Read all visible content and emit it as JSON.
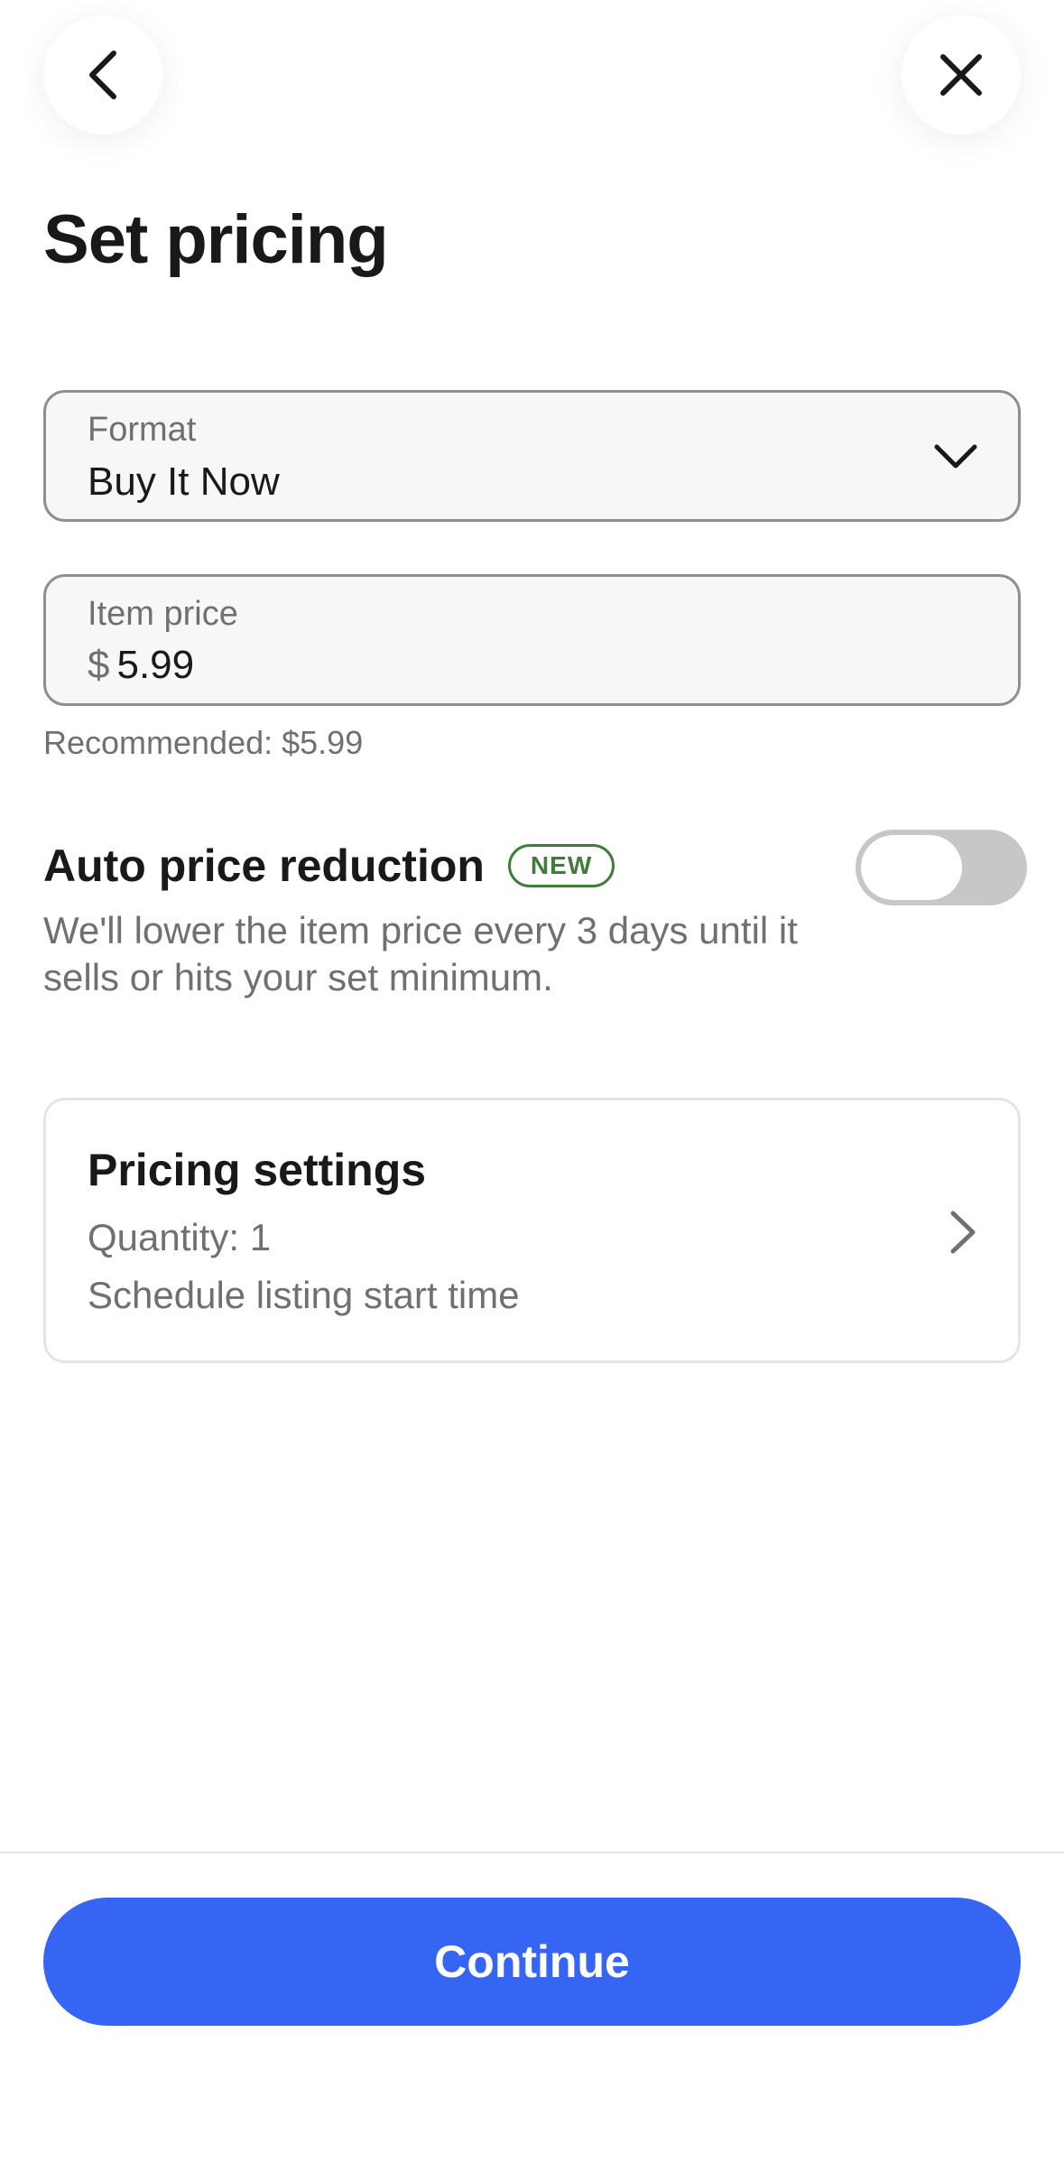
{
  "header": {
    "back_icon": "chevron-left-icon",
    "close_icon": "close-icon",
    "title": "Set pricing"
  },
  "format_field": {
    "label": "Format",
    "value": "Buy It Now",
    "icon": "chevron-down-icon"
  },
  "price_field": {
    "label": "Item price",
    "currency": "$",
    "value": "5.99"
  },
  "recommended": "Recommended: $5.99",
  "auto_price_reduction": {
    "title": "Auto price reduction",
    "badge": "NEW",
    "description": "We'll lower the item price every 3 days until it sells or hits your set minimum.",
    "enabled": false
  },
  "pricing_settings": {
    "title": "Pricing settings",
    "quantity": "Quantity: 1",
    "schedule": "Schedule listing start time",
    "icon": "chevron-right-icon"
  },
  "footer": {
    "continue_label": "Continue"
  },
  "colors": {
    "accent": "#3665f3",
    "badge_green": "#3e7e3a",
    "secondary_text": "#707070"
  }
}
